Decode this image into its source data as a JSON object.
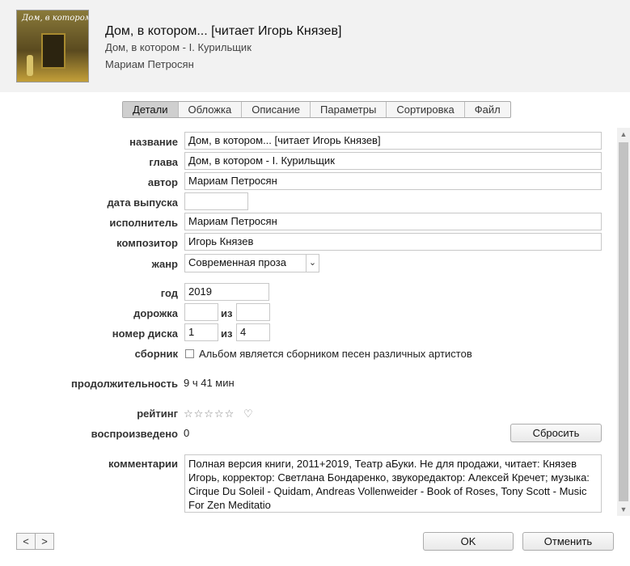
{
  "header": {
    "cover_text": "Дом, в котором...",
    "title": "Дом, в котором... [читает Игорь Князев]",
    "subtitle": "Дом, в котором - I. Курильщик",
    "artist": "Мариам Петросян"
  },
  "tabs": [
    {
      "label": "Детали",
      "active": true
    },
    {
      "label": "Обложка"
    },
    {
      "label": "Описание"
    },
    {
      "label": "Параметры"
    },
    {
      "label": "Сортировка"
    },
    {
      "label": "Файл"
    }
  ],
  "fields": {
    "name": {
      "label": "название",
      "value": "Дом, в котором... [читает Игорь Князев]"
    },
    "chapter": {
      "label": "глава",
      "value": "Дом, в котором - I. Курильщик"
    },
    "author": {
      "label": "автор",
      "value": "Мариам Петросян"
    },
    "release_date": {
      "label": "дата выпуска",
      "value": ""
    },
    "performer": {
      "label": "исполнитель",
      "value": "Мариам Петросян"
    },
    "composer": {
      "label": "композитор",
      "value": "Игорь Князев"
    },
    "genre": {
      "label": "жанр",
      "value": "Современная проза"
    },
    "year": {
      "label": "год",
      "value": "2019"
    },
    "track": {
      "label": "дорожка",
      "value": "",
      "of_label": "из",
      "of_value": ""
    },
    "disc": {
      "label": "номер диска",
      "value": "1",
      "of_label": "из",
      "of_value": "4"
    },
    "compilation": {
      "label": "сборник",
      "checkbox_text": "Альбом является сборником песен различных артистов",
      "checked": false
    },
    "duration": {
      "label": "продолжительность",
      "value": "9 ч 41 мин"
    },
    "rating": {
      "label": "рейтинг",
      "stars": "☆☆☆☆☆",
      "stars_value": 0,
      "heart": "♡"
    },
    "plays": {
      "label": "воспроизведено",
      "value": "0",
      "reset_label": "Сбросить"
    },
    "comments": {
      "label": "комментарии",
      "value": "Полная версия книги, 2011+2019, Театр аБуки. Не для продажи, читает: Князев Игорь, корректор: Светлана Бондаренко, звукоредактор: Алексей Кречет; музыка: Cirque Du Soleil - Quidam, Andreas Vollenweider - Book of Roses, Tony Scott - Music For Zen Meditatio"
    }
  },
  "footer": {
    "prev": "<",
    "next": ">",
    "ok_label": "OK",
    "cancel_label": "Отменить"
  }
}
